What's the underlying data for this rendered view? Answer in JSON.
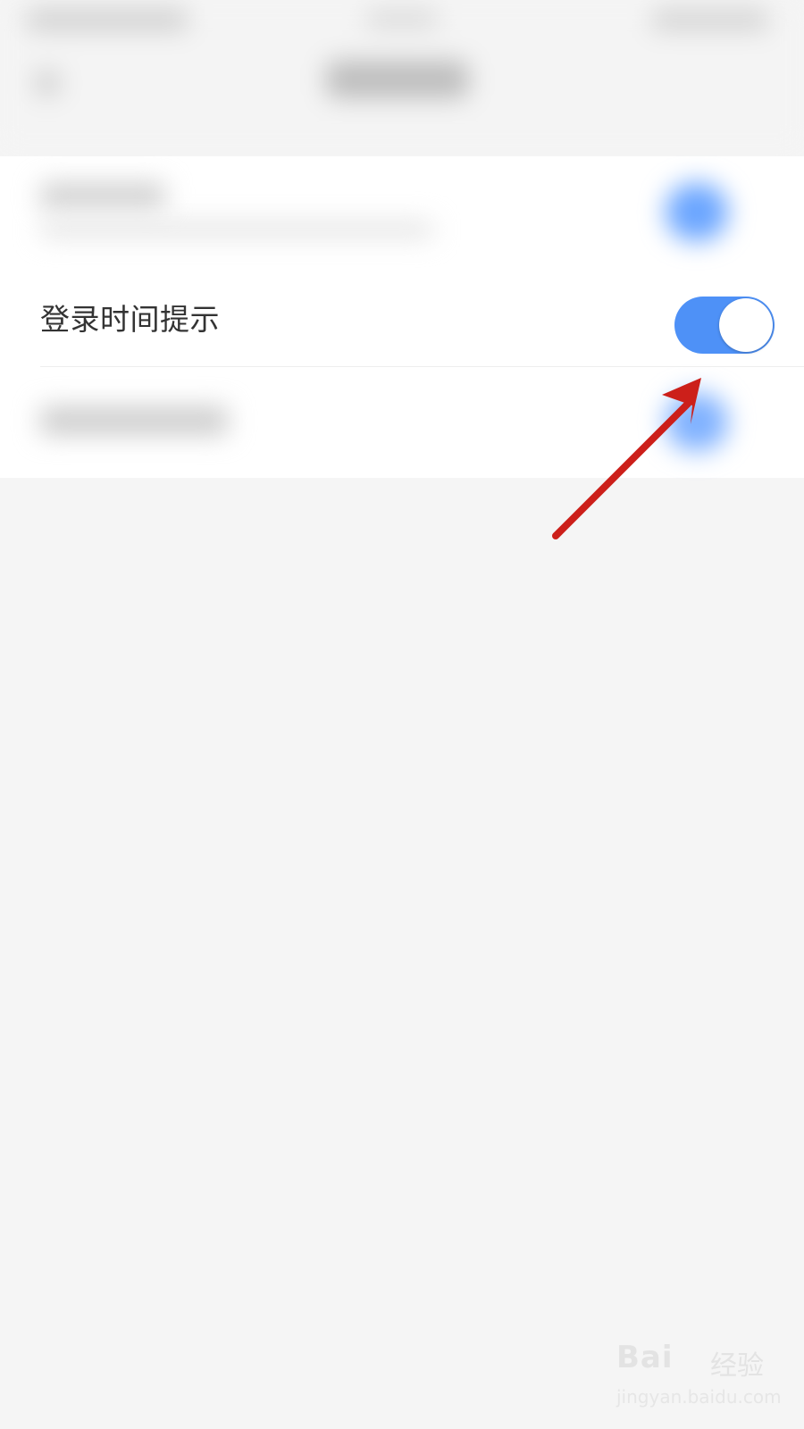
{
  "settings": {
    "login_time_reminder": {
      "label": "登录时间提示",
      "enabled": true
    }
  },
  "colors": {
    "toggle_on": "#4e91f7",
    "annotation_arrow": "#cc1f1a",
    "background": "#f5f5f5"
  },
  "watermark": {
    "brand": "Bai",
    "product": "经验",
    "url": "jingyan.baidu.com"
  }
}
